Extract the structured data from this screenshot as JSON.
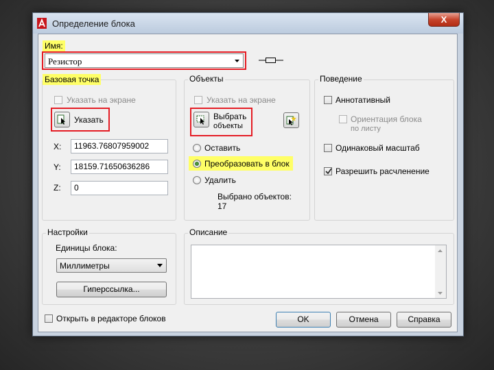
{
  "window": {
    "title": "Определение блока",
    "close_label": "X"
  },
  "name_field": {
    "label": "Имя:",
    "value": "Резистор"
  },
  "base_point": {
    "title": "Базовая точка",
    "on_screen_label": "Указать на экране",
    "pick_label": "Указать",
    "x_label": "X:",
    "x_value": "11963.76807959002",
    "y_label": "Y:",
    "y_value": "18159.71650636286",
    "z_label": "Z:",
    "z_value": "0"
  },
  "objects": {
    "title": "Объекты",
    "on_screen_label": "Указать на экране",
    "select_label_line1": "Выбрать",
    "select_label_line2": "объекты",
    "retain_label": "Оставить",
    "convert_label": "Преобразовать в блок",
    "delete_label": "Удалить",
    "selected_count_label": "Выбрано объектов:",
    "selected_count": "17"
  },
  "behavior": {
    "title": "Поведение",
    "annotative_label": "Аннотативный",
    "orientation_line1": "Ориентация блока",
    "orientation_line2": "по листу",
    "uniform_scale_label": "Одинаковый масштаб",
    "allow_explode_label": "Разрешить расчленение"
  },
  "settings": {
    "title": "Настройки",
    "units_label": "Единицы блока:",
    "units_value": "Миллиметры",
    "hyperlink_label": "Гиперссылка..."
  },
  "description": {
    "title": "Описание"
  },
  "footer": {
    "open_in_editor_label": "Открыть в редакторе блоков",
    "ok_label": "OK",
    "cancel_label": "Отмена",
    "help_label": "Справка"
  },
  "colors": {
    "highlight": "#ffff66",
    "annotation_border": "#e41b23",
    "close_button": "#c7452d"
  }
}
